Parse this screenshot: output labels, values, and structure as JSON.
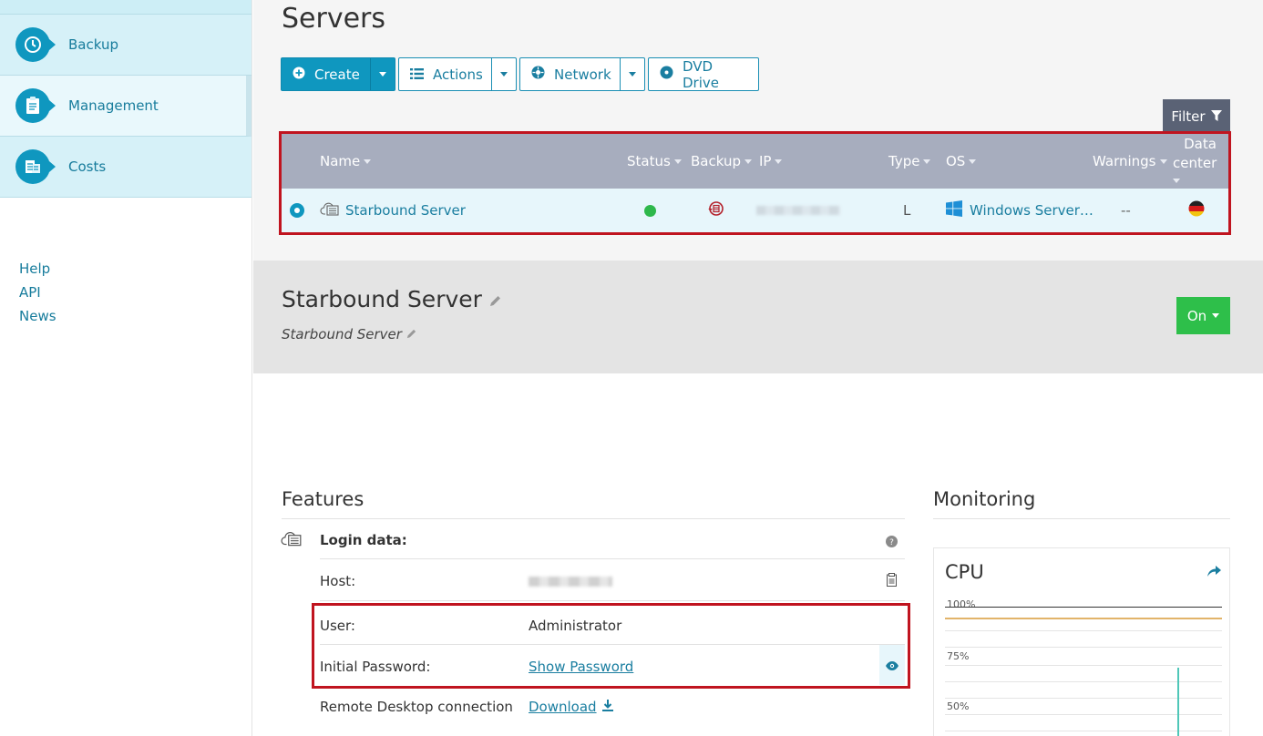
{
  "sidebar": {
    "items": [
      {
        "label": "Backup",
        "icon": "backup-clock-icon"
      },
      {
        "label": "Management",
        "icon": "clipboard-icon"
      },
      {
        "label": "Costs",
        "icon": "costs-icon"
      }
    ],
    "links": [
      "Help",
      "API",
      "News"
    ]
  },
  "page": {
    "title": "Servers"
  },
  "toolbar": {
    "create": "Create",
    "actions": "Actions",
    "network": "Network",
    "dvd": "DVD Drive",
    "filter": "Filter"
  },
  "table": {
    "headers": {
      "name": "Name",
      "status": "Status",
      "backup": "Backup",
      "ip": "IP",
      "type": "Type",
      "os": "OS",
      "warnings": "Warnings",
      "datacenter_line1": "Data",
      "datacenter_line2": "center"
    },
    "row": {
      "name": "Starbound Server",
      "status_color": "#2eb84b",
      "type": "L",
      "os": "Windows Server…",
      "warnings": "--"
    }
  },
  "detail": {
    "title": "Starbound Server",
    "subtitle": "Starbound Server",
    "power": "On"
  },
  "features": {
    "title": "Features",
    "login_label": "Login data:",
    "host_label": "Host:",
    "user_label": "User:",
    "user_value": "Administrator",
    "password_label": "Initial Password:",
    "password_link": "Show Password",
    "rdp_label": "Remote Desktop connection",
    "rdp_link": "Download"
  },
  "monitoring": {
    "title": "Monitoring",
    "cpu_title": "CPU",
    "axis": [
      "100%",
      "75%",
      "50%"
    ]
  },
  "colors": {
    "accent": "#0f97bf",
    "highlight": "#c0141f",
    "power_on": "#2ebf4a",
    "table_header": "#a7adbe"
  }
}
